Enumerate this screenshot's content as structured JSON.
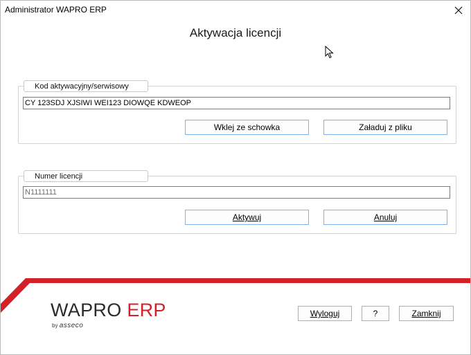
{
  "window": {
    "title": "Administrator WAPRO ERP"
  },
  "heading": "Aktywacja licencji",
  "activation_group": {
    "label": "Kod aktywacyjny/serwisowy",
    "code_value": "CY 123SDJ XJSIWI WEI123 DIOWQE KDWEOP",
    "paste_button": "Wklej ze schowka",
    "load_button": "Załaduj z pliku"
  },
  "license_group": {
    "label": "Numer licencji",
    "license_value": "N1111111",
    "activate_button": "Aktywuj",
    "cancel_button": "Anuluj"
  },
  "brand": {
    "name_part1": "WAPRO",
    "name_part2": "ERP",
    "by": "by",
    "company": "asseco",
    "accent": "#d42027"
  },
  "footer_buttons": {
    "logout": "Wyloguj",
    "help": "?",
    "close": "Zamknij"
  }
}
